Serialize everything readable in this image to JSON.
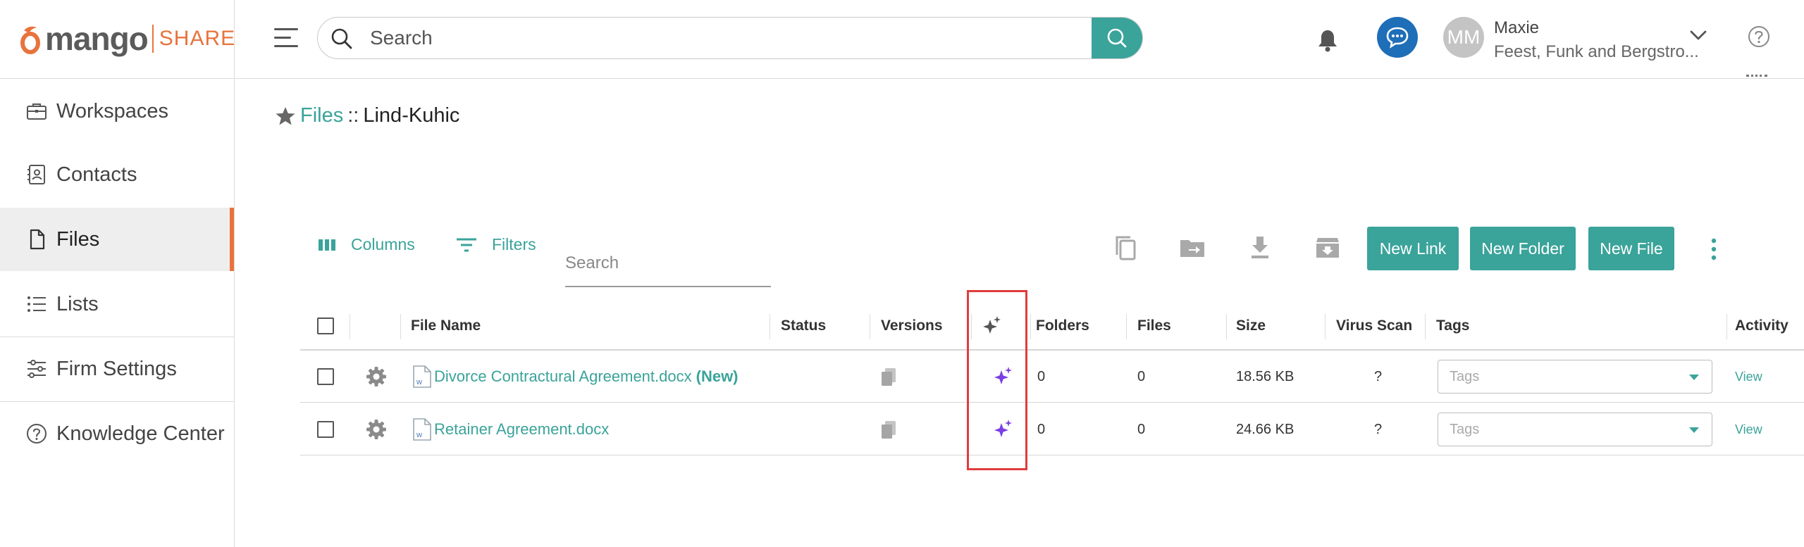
{
  "brand": {
    "logo_word": "mango",
    "logo_suffix": "SHARE",
    "accent": "#e8733c",
    "primary": "#3aa39a"
  },
  "header": {
    "search_placeholder": "Search",
    "user_initials": "MM",
    "user_name": "Maxie",
    "user_org": "Feest, Funk and Bergstro..."
  },
  "sidebar": {
    "items": [
      {
        "label": "Workspaces",
        "icon": "briefcase-icon"
      },
      {
        "label": "Contacts",
        "icon": "contact-card-icon"
      },
      {
        "label": "Files",
        "icon": "file-icon",
        "active": true
      },
      {
        "label": "Lists",
        "icon": "list-icon"
      },
      {
        "label": "Firm Settings",
        "icon": "sliders-icon"
      },
      {
        "label": "Knowledge Center",
        "icon": "help-circle-icon"
      }
    ]
  },
  "breadcrumb": {
    "root": "Files",
    "separator": "::",
    "current": "Lind-Kuhic"
  },
  "toolbar": {
    "columns_label": "Columns",
    "filters_label": "Filters",
    "search_placeholder": "Search",
    "new_link": "New Link",
    "new_folder": "New Folder",
    "new_file": "New File"
  },
  "table": {
    "headers": {
      "file_name": "File Name",
      "status": "Status",
      "versions": "Versions",
      "folders": "Folders",
      "files": "Files",
      "size": "Size",
      "virus_scan": "Virus Scan",
      "tags": "Tags",
      "activity": "Activity"
    },
    "rows": [
      {
        "name": "Divorce Contractural Agreement.docx",
        "badge": "(New)",
        "status": "",
        "folders": "0",
        "files": "0",
        "size": "18.56 KB",
        "virus_scan": "?",
        "tags_placeholder": "Tags",
        "activity": "View"
      },
      {
        "name": "Retainer Agreement.docx",
        "badge": "",
        "status": "",
        "folders": "0",
        "files": "0",
        "size": "24.66 KB",
        "virus_scan": "?",
        "tags_placeholder": "Tags",
        "activity": "View"
      }
    ]
  }
}
